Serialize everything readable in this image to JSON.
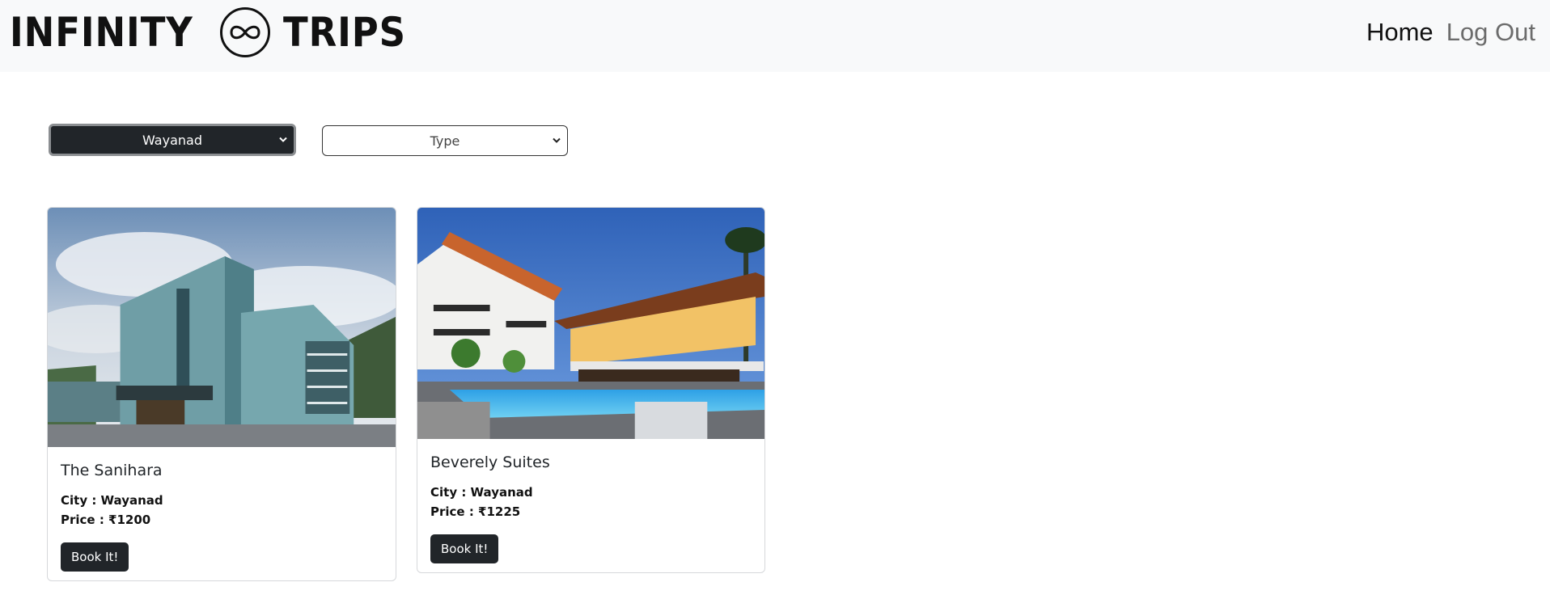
{
  "brand": {
    "word1": "INFINITY",
    "word2": "TRIPS"
  },
  "nav": {
    "home": "Home",
    "logout": "Log Out"
  },
  "filters": {
    "city_selected": "Wayanad",
    "type_selected": "Type"
  },
  "cards": [
    {
      "title": "The Sanihara",
      "city": "City : Wayanad",
      "price": "Price : ₹1200",
      "button": "Book It!"
    },
    {
      "title": "Beverely Suites",
      "city": "City : Wayanad",
      "price": "Price : ₹1225",
      "button": "Book It!"
    }
  ],
  "colors": {
    "navbar_bg": "#f8f9fa",
    "dark": "#212529",
    "muted_link": "#6c6c6c"
  }
}
